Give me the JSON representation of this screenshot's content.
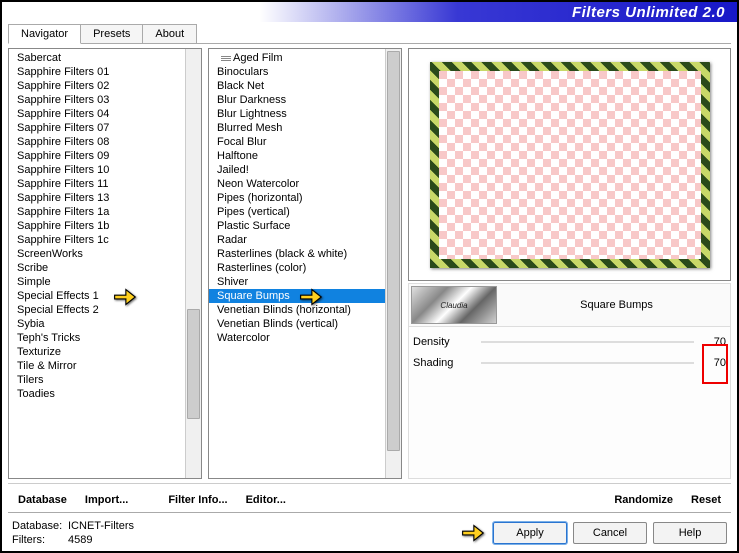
{
  "title": "Filters Unlimited 2.0",
  "tabs": [
    "Navigator",
    "Presets",
    "About"
  ],
  "active_tab": 0,
  "categories": [
    "Sabercat",
    "Sapphire Filters 01",
    "Sapphire Filters 02",
    "Sapphire Filters 03",
    "Sapphire Filters 04",
    "Sapphire Filters 07",
    "Sapphire Filters 08",
    "Sapphire Filters 09",
    "Sapphire Filters 10",
    "Sapphire Filters 11",
    "Sapphire Filters 13",
    "Sapphire Filters 1a",
    "Sapphire Filters 1b",
    "Sapphire Filters 1c",
    "ScreenWorks",
    "Scribe",
    "Simple",
    "Special Effects 1",
    "Special Effects 2",
    "Sybia",
    "Teph's Tricks",
    "Texturize",
    "Tile & Mirror",
    "Tilers",
    "Toadies"
  ],
  "selected_category_index": 17,
  "effects": [
    "Aged Film",
    "Binoculars",
    "Black Net",
    "Blur Darkness",
    "Blur Lightness",
    "Blurred Mesh",
    "Focal Blur",
    "Halftone",
    "Jailed!",
    "Neon Watercolor",
    "Pipes (horizontal)",
    "Pipes (vertical)",
    "Plastic Surface",
    "Radar",
    "Rasterlines (black & white)",
    "Rasterlines (color)",
    "Shiver",
    "Square Bumps",
    "Venetian Blinds (horizontal)",
    "Venetian Blinds (vertical)",
    "Watercolor"
  ],
  "selected_effect_index": 17,
  "selected_effect_name": "Square Bumps",
  "author_thumb_text": "Claudia",
  "params": [
    {
      "label": "Density",
      "value": 70
    },
    {
      "label": "Shading",
      "value": 70
    }
  ],
  "upper_buttons": {
    "database": "Database",
    "import": "Import...",
    "filter_info": "Filter Info...",
    "editor": "Editor...",
    "randomize": "Randomize",
    "reset": "Reset"
  },
  "status": {
    "db_label": "Database:",
    "db_value": "ICNET-Filters",
    "filters_label": "Filters:",
    "filters_value": "4589"
  },
  "dialog_buttons": {
    "apply": "Apply",
    "cancel": "Cancel",
    "help": "Help"
  }
}
